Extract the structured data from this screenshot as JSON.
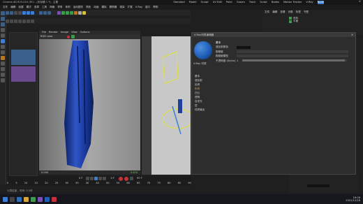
{
  "window": {
    "title": "Cinema 4D R25.010 (RC) - [未标题 1 *] - 主要",
    "layouts": [
      "Standard",
      "Model",
      "Sculpt",
      "UV Edit",
      "Paint",
      "Groom",
      "Track",
      "Script",
      "Nodes",
      "Motion Tracker",
      "V-Ray",
      "Node"
    ]
  },
  "menubar": {
    "items": [
      "文件",
      "编辑",
      "创建",
      "模式",
      "选择",
      "工具",
      "网格",
      "样条",
      "体积",
      "运动图形",
      "角色",
      "动画",
      "模拟",
      "跟踪器",
      "渲染",
      "扩展",
      "V-Ray",
      "窗口",
      "帮助"
    ]
  },
  "objects": {
    "header": [
      "文件",
      "编辑",
      "查看",
      "对象",
      "标签",
      "书签"
    ],
    "items": [
      "布料",
      "平面"
    ]
  },
  "viewer": {
    "tab": "V-Ray VFB",
    "header": "Histogram",
    "menu": [
      "File",
      "Render",
      "Image",
      "View",
      "Options"
    ],
    "status": "RGB color",
    "footer_value": "0.000",
    "footer_right": "0.000"
  },
  "dialog": {
    "title": "V-Ray材质编辑器",
    "basic_label": "基本",
    "diffuse_label": "漫反射颜色",
    "roughness_label": "粗糙度",
    "rough_model_label": "粗糙度模型",
    "opacity_label": "不透明度 (Alpha)",
    "opacity_value": "1",
    "material_name": "V-Ray 材质",
    "channels": [
      "基本",
      "漫反射",
      "反射",
      "折射",
      "凹凸",
      "透明",
      "自发光",
      "层",
      "材质输出"
    ],
    "selected_channel": 3,
    "opacity_fraction": 0.98,
    "swatch_color": "#1f5fb8"
  },
  "timeline": {
    "start": "0 F",
    "end": "90 F",
    "current": "0 F",
    "ticks": [
      "0",
      "5",
      "10",
      "15",
      "20",
      "25",
      "30",
      "35",
      "40",
      "45",
      "50",
      "55",
      "60",
      "65",
      "70",
      "75",
      "80",
      "85",
      "90"
    ]
  },
  "taskbar": {
    "time": "16:06",
    "date": "2021/12/28",
    "status": "计算结束，时间: 0.5秒"
  },
  "colors": {
    "accent": "#3b7fd6",
    "cloth": "#1f3f9c",
    "selection": "#e2e23a",
    "record": "#c7303a",
    "panel": "#2d2d2d"
  },
  "icons": [
    "move-icon",
    "rotate-icon",
    "scale-icon",
    "render-icon",
    "play-icon",
    "record-icon",
    "search-icon",
    "close-icon",
    "windows-icon"
  ]
}
